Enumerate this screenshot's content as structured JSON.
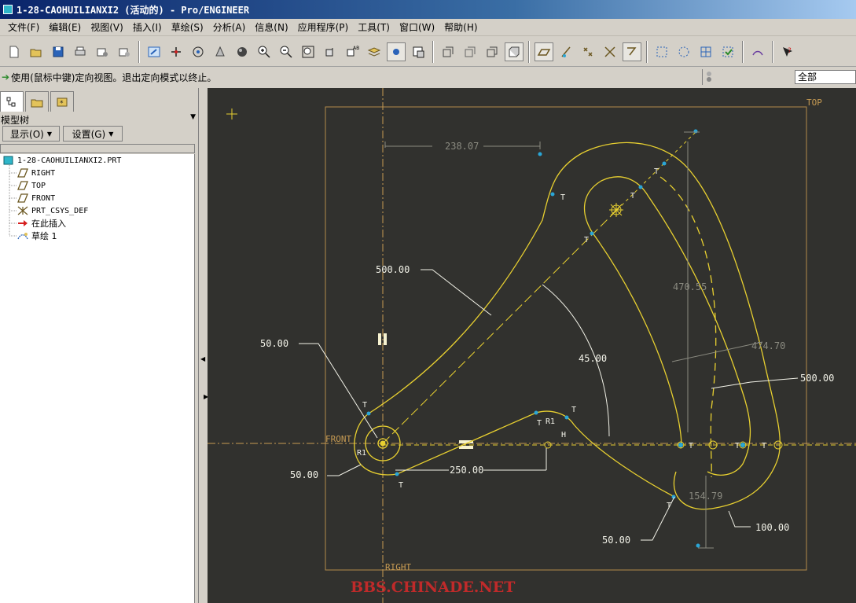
{
  "window": {
    "title": "1-28-CAOHUILIANXI2 (活动的) - Pro/ENGINEER"
  },
  "menu": [
    "文件(F)",
    "编辑(E)",
    "视图(V)",
    "插入(I)",
    "草绘(S)",
    "分析(A)",
    "信息(N)",
    "应用程序(P)",
    "工具(T)",
    "窗口(W)",
    "帮助(H)"
  ],
  "toolbar_icons": [
    "new-icon",
    "open-icon",
    "save-icon",
    "print-icon",
    "send-icon",
    "email-icon",
    "redraw-icon",
    "spin-center-icon",
    "orient-mode-icon",
    "shade-icon",
    "sphere-icon",
    "zoom-in-icon",
    "zoom-out-icon",
    "refit-icon",
    "reorient-icon",
    "saved-views-icon",
    "layers-icon",
    "setup-icon",
    "model-display-icon",
    "wireframe-icon",
    "hidden-line-icon",
    "no-hidden-icon",
    "shading-icon",
    "datum-planes-icon",
    "datum-axes-icon",
    "datum-points-icon",
    "csys-icon",
    "annotation-icon",
    "select-icon",
    "box-select-icon",
    "grid-icon",
    "verify-icon",
    "sketch-tool-icon",
    "help-icon"
  ],
  "message": {
    "text": "使用(鼠标中键)定向视图。退出定向模式以终止。"
  },
  "filter": {
    "value": "全部"
  },
  "model_tree": {
    "header": "模型树",
    "show_button": "显示(O)",
    "settings_button": "设置(G)",
    "items": [
      {
        "label": "1-28-CAOHUILIANXI2.PRT",
        "icon": "part-icon"
      },
      {
        "label": "RIGHT",
        "icon": "datum-plane-icon"
      },
      {
        "label": "TOP",
        "icon": "datum-plane-icon"
      },
      {
        "label": "FRONT",
        "icon": "datum-plane-icon"
      },
      {
        "label": "PRT_CSYS_DEF",
        "icon": "csys-icon"
      },
      {
        "label": "在此插入",
        "icon": "insert-here-icon"
      },
      {
        "label": "草绘 1",
        "icon": "sketch-icon"
      }
    ]
  },
  "canvas": {
    "datum_labels": {
      "top": "TOP",
      "front": "FRONT",
      "right": "RIGHT"
    },
    "dimensions": {
      "d238": "238.07",
      "d500a": "500.00",
      "d50a": "50.00",
      "d45": "45.00",
      "d50b": "50.00",
      "d250": "250.00",
      "d470": "470.55",
      "d474": "474.70",
      "d500b": "500.00",
      "d154": "154.79",
      "d50c": "50.00",
      "d100": "100.00"
    },
    "constraints": {
      "T": "T",
      "R1": "R1",
      "H": "H"
    },
    "watermark": "BBS.CHINADE.NET",
    "colors": {
      "background": "#31312e",
      "sketch": "#e8d030",
      "datum": "#c79b53",
      "dimension": "#f2f2e8",
      "point": "#2aa6d6"
    }
  }
}
